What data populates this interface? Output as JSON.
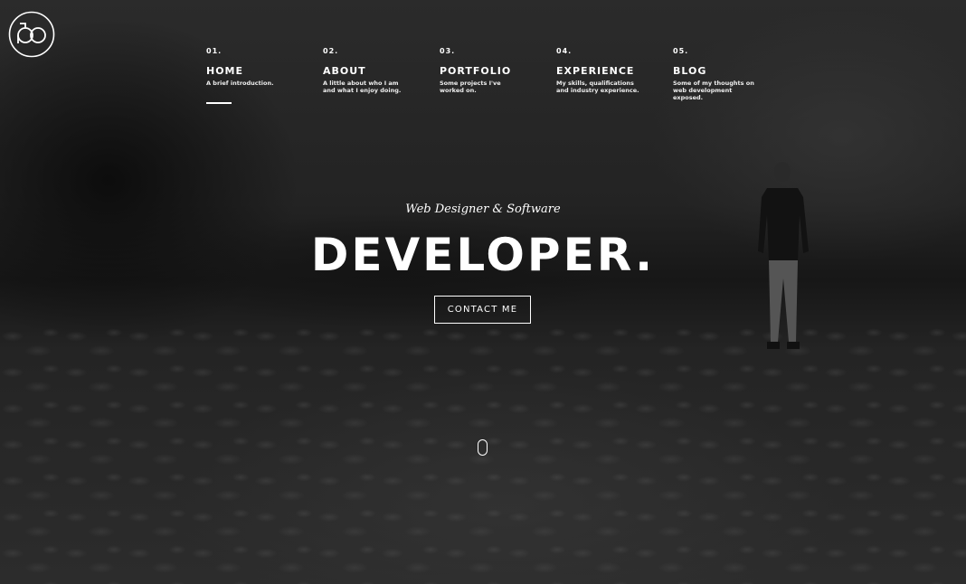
{
  "nav": {
    "items": [
      {
        "number": "01.",
        "title": "HOME",
        "description": "A brief introduction."
      },
      {
        "number": "02.",
        "title": "ABOUT",
        "description": "A little about who I am and what I enjoy doing."
      },
      {
        "number": "03.",
        "title": "PORTFOLIO",
        "description": "Some projects I've worked on."
      },
      {
        "number": "04.",
        "title": "EXPERIENCE",
        "description": "My skills, qualifications and industry experience."
      },
      {
        "number": "05.",
        "title": "BLOG",
        "description": "Some of my thoughts on web development exposed."
      }
    ],
    "active_index": 0
  },
  "hero": {
    "tagline": "Web Designer & Software",
    "headline": "DEVELOPER.",
    "contact_label": "CONTACT ME"
  },
  "icons": {
    "logo": "logo-icon",
    "scroll": "scroll-mouse-icon"
  },
  "colors": {
    "text": "#ffffff",
    "background": "#1c1c1c"
  }
}
